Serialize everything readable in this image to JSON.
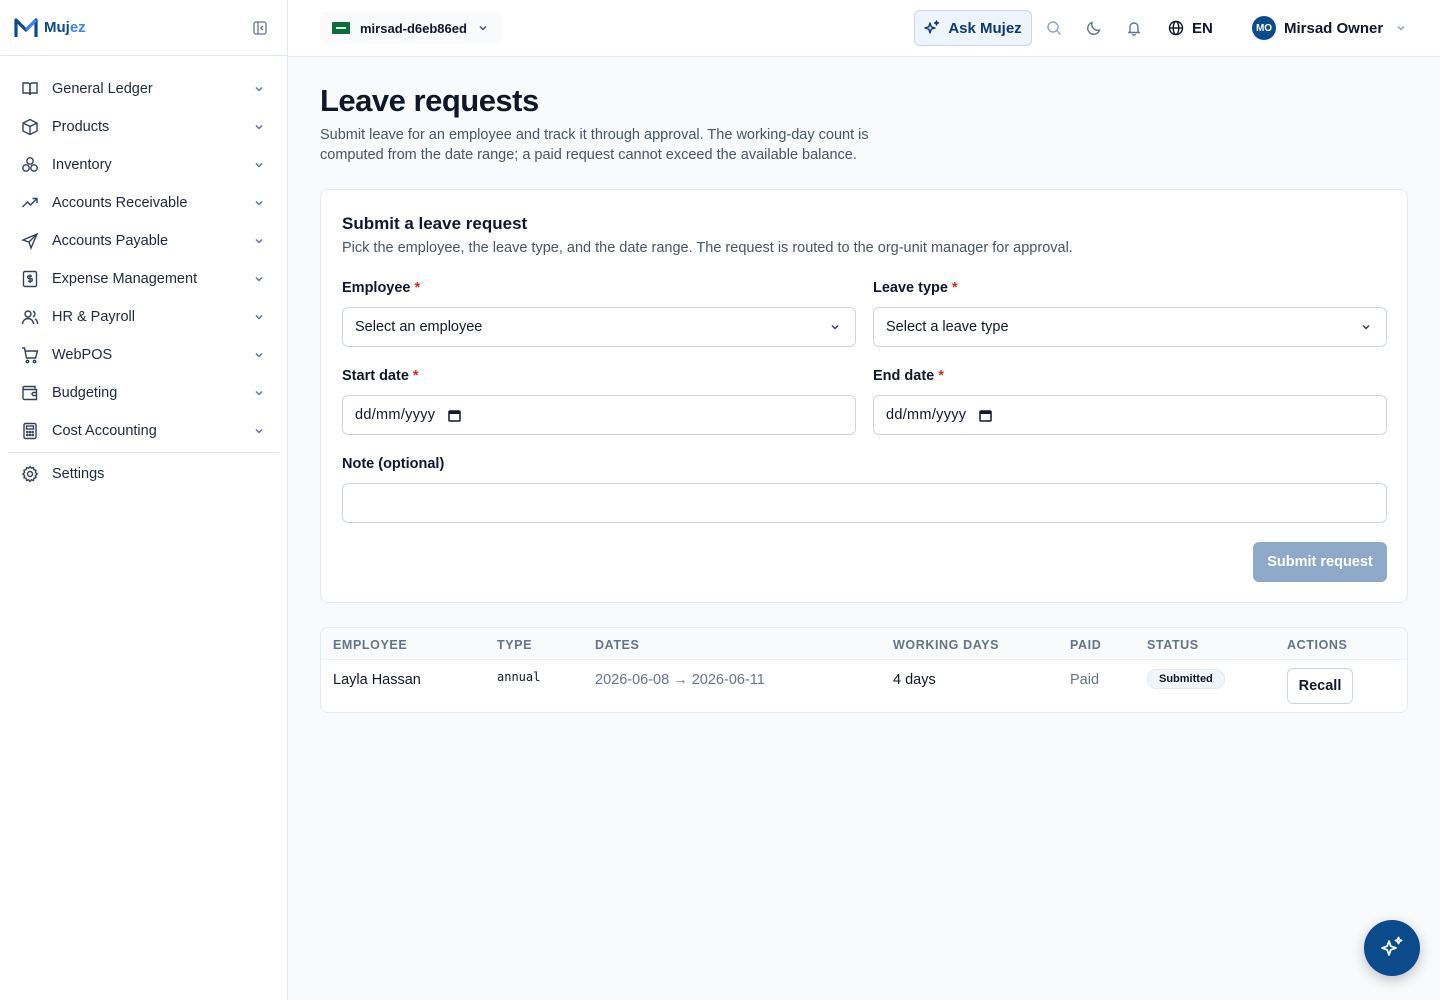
{
  "brand": {
    "name_main": "Muj",
    "name_accent": "ez"
  },
  "sidebar": {
    "items": [
      {
        "label": "General Ledger",
        "icon": "book-icon"
      },
      {
        "label": "Products",
        "icon": "box-icon"
      },
      {
        "label": "Inventory",
        "icon": "boxes-icon"
      },
      {
        "label": "Accounts Receivable",
        "icon": "trend-up-icon"
      },
      {
        "label": "Accounts Payable",
        "icon": "send-icon"
      },
      {
        "label": "Expense Management",
        "icon": "receipt-icon"
      },
      {
        "label": "HR & Payroll",
        "icon": "users-icon"
      },
      {
        "label": "WebPOS",
        "icon": "cart-icon"
      },
      {
        "label": "Budgeting",
        "icon": "wallet-icon"
      },
      {
        "label": "Cost Accounting",
        "icon": "calculator-icon"
      }
    ],
    "settings_label": "Settings"
  },
  "topbar": {
    "org_name": "mirsad-d6eb86ed",
    "ask_label": "Ask Mujez",
    "language": "EN",
    "user_initials": "MO",
    "user_name": "Mirsad Owner"
  },
  "page": {
    "title": "Leave requests",
    "description": "Submit leave for an employee and track it through approval. The working-day count is computed from the date range; a paid request cannot exceed the available balance."
  },
  "form": {
    "title": "Submit a leave request",
    "description": "Pick the employee, the leave type, and the date range. The request is routed to the org-unit manager for approval.",
    "employee_label": "Employee",
    "employee_value": "Select an employee",
    "leave_type_label": "Leave type",
    "leave_type_value": "Select a leave type",
    "start_label": "Start date",
    "start_placeholder": "dd/mm/yyyy",
    "end_label": "End date",
    "end_placeholder": "dd/mm/yyyy",
    "note_label": "Note (optional)",
    "note_value": "",
    "required_mark": "*",
    "submit_label": "Submit request"
  },
  "table": {
    "headers": [
      "EMPLOYEE",
      "TYPE",
      "DATES",
      "WORKING DAYS",
      "PAID",
      "STATUS",
      "ACTIONS"
    ],
    "rows": [
      {
        "employee": "Layla Hassan",
        "type": "annual",
        "dates": "2026-06-08 → 2026-06-11",
        "working_days": "4 days",
        "paid": "Paid",
        "status": "Submitted",
        "action": "Recall"
      }
    ]
  },
  "colors": {
    "brand": "#0b4a8b",
    "accent": "#3b82f6",
    "required": "#dc2626",
    "submit_disabled": "#8fa9c8"
  }
}
